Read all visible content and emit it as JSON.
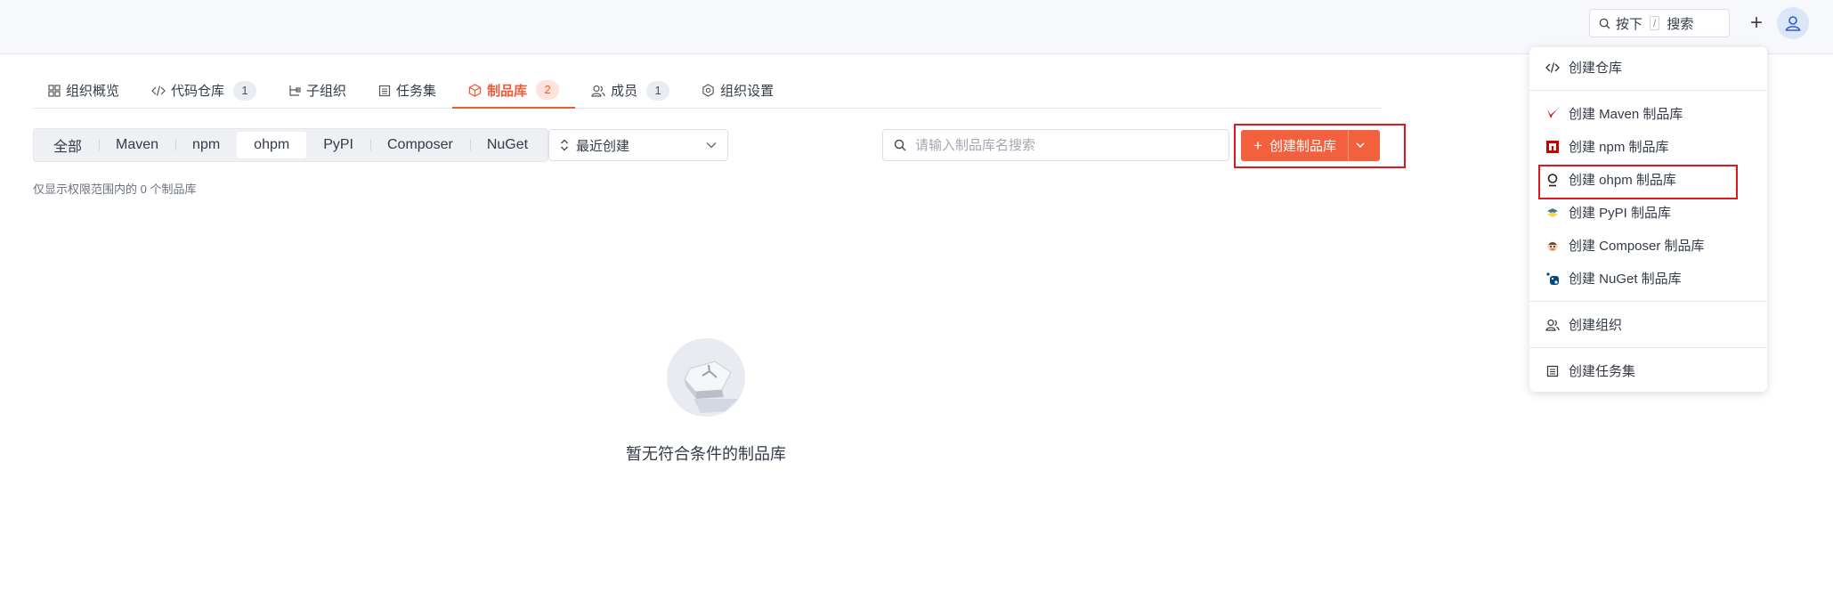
{
  "topbar": {
    "shortcut_prefix": "按下",
    "shortcut_key": "/",
    "shortcut_suffix": "搜索"
  },
  "tabs": [
    {
      "label": "组织概览",
      "icon": "grid-icon"
    },
    {
      "label": "代码仓库",
      "icon": "code-icon",
      "count": "1"
    },
    {
      "label": "子组织",
      "icon": "sub-org-icon"
    },
    {
      "label": "任务集",
      "icon": "list-icon"
    },
    {
      "label": "制品库",
      "icon": "package-icon",
      "count": "2",
      "active": true
    },
    {
      "label": "成员",
      "icon": "members-icon",
      "count": "1"
    },
    {
      "label": "组织设置",
      "icon": "settings-icon"
    }
  ],
  "filters": [
    "全部",
    "Maven",
    "npm",
    "ohpm",
    "PyPI",
    "Composer",
    "NuGet"
  ],
  "selected_filter": "ohpm",
  "sort": {
    "selected": "最近创建"
  },
  "search": {
    "placeholder": "请输入制品库名搜索"
  },
  "create_button": {
    "label": "创建制品库"
  },
  "note": "仅显示权限范围内的 0 个制品库",
  "empty": {
    "text": "暂无符合条件的制品库"
  },
  "menu": {
    "create_repo": "创建仓库",
    "create_maven": "创建 Maven 制品库",
    "create_npm": "创建 npm 制品库",
    "create_ohpm": "创建 ohpm 制品库",
    "create_pypi": "创建 PyPI 制品库",
    "create_composer": "创建 Composer 制品库",
    "create_nuget": "创建 NuGet 制品库",
    "create_org": "创建组织",
    "create_taskset": "创建任务集"
  },
  "colors": {
    "accent": "#f05a38",
    "highlight_box": "#e0151e"
  }
}
